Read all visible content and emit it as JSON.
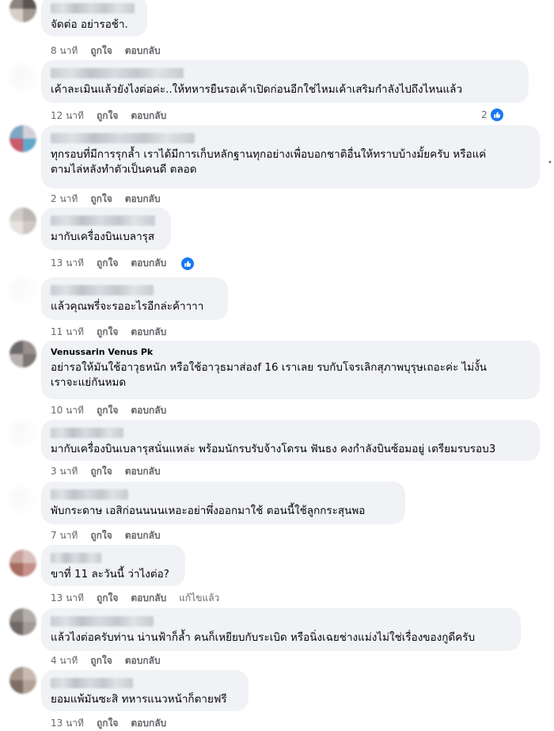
{
  "colors": {
    "bubble": "#f0f2f5",
    "meta": "#65676b",
    "like": "#1877f2"
  },
  "comments": [
    {
      "name": "",
      "text": "จัดต่อ อย่ารอช้า.",
      "time": "8 นาที",
      "like": "ถูกใจ",
      "reply": "ตอบกลับ",
      "extra": "",
      "reactions": ""
    },
    {
      "name": "",
      "text": "เค้าละเมินแล้วยังไงต่อค่ะ..ให้ทหารยืนรอเค้าเปิดก่อนอีกใช่ไหมเค้าเสริมกำลังไปถึงไหนแล้ว",
      "time": "12 นาที",
      "like": "ถูกใจ",
      "reply": "ตอบกลับ",
      "extra": "",
      "reactions": "2"
    },
    {
      "name": "",
      "text": "ทุกรอบที่มีการรุกล้ำ เราได้มีการเก็บหลักฐานทุกอย่างเพื่อบอกชาติอื่นให้ทราบบ้างมั้ยครับ หรือแค่\nตามไล่หลังทำตัวเป็นคนดี ตลอด",
      "time": "2 นาที",
      "like": "ถูกใจ",
      "reply": "ตอบกลับ",
      "extra": "",
      "reactions": ""
    },
    {
      "name": "",
      "text": "มากับเครื่องบินเบลารุส",
      "time": "13 นาที",
      "like": "ถูกใจ",
      "reply": "ตอบกลับ",
      "extra": "",
      "reactions": ""
    },
    {
      "name": "",
      "text": "แล้วคุณพรี่จะรออะไรอีกล่ะค้าาาา",
      "time": "11 นาที",
      "like": "ถูกใจ",
      "reply": "ตอบกลับ",
      "extra": "",
      "reactions": ""
    },
    {
      "name": "Venussarin Venus Pk",
      "text": "อย่ารอให้มันใช้อาวุธหนัก หรือใช้อาวุธมาส่องf 16 เราเลย รบกับโจรเลิกสุภาพบุรุษเถอะค่ะ ไม่งั้น\nเราจะแย่กันหมด",
      "time": "10 นาที",
      "like": "ถูกใจ",
      "reply": "ตอบกลับ",
      "extra": "",
      "reactions": ""
    },
    {
      "name": "",
      "text": "มากับเครื่องบินเบลารุสนั่นแหล่ะ พร้อมนักรบรับจ้างโดรน ฟันธง คงกำลังบินซ้อมอยู่ เตรียมรบรอบ3",
      "time": "3 นาที",
      "like": "ถูกใจ",
      "reply": "ตอบกลับ",
      "extra": "",
      "reactions": ""
    },
    {
      "name": "",
      "text": "พับกระดาษ เอสิก่อนนนนเหอะอย่าพึ่งออกมาใช้ ตอนนี้ใช้ลูกกระสุนพอ",
      "time": "7 นาที",
      "like": "ถูกใจ",
      "reply": "ตอบกลับ",
      "extra": "",
      "reactions": ""
    },
    {
      "name": "",
      "text": "ขาที่ 11 ละวันนี้ ว่าไงต่อ?",
      "time": "13 นาที",
      "like": "ถูกใจ",
      "reply": "ตอบกลับ",
      "extra": "แก้ไขแล้ว",
      "reactions": ""
    },
    {
      "name": "",
      "text": "แล้วไงต่อครับท่าน น่านฟ้าก็ล้ำ คนก็เหยียบกับระเบิด หรือนิ่งเฉยช่างแม่งไม่ใช่เรื่องของกูดีครับ",
      "time": "4 นาที",
      "like": "ถูกใจ",
      "reply": "ตอบกลับ",
      "extra": "",
      "reactions": ""
    },
    {
      "name": "",
      "text": "ยอมแพ้มันซะสิ ทหารแนวหน้าก็ตายฟรี",
      "time": "13 นาที",
      "like": "ถูกใจ",
      "reply": "ตอบกลับ",
      "extra": "",
      "reactions": ""
    }
  ]
}
